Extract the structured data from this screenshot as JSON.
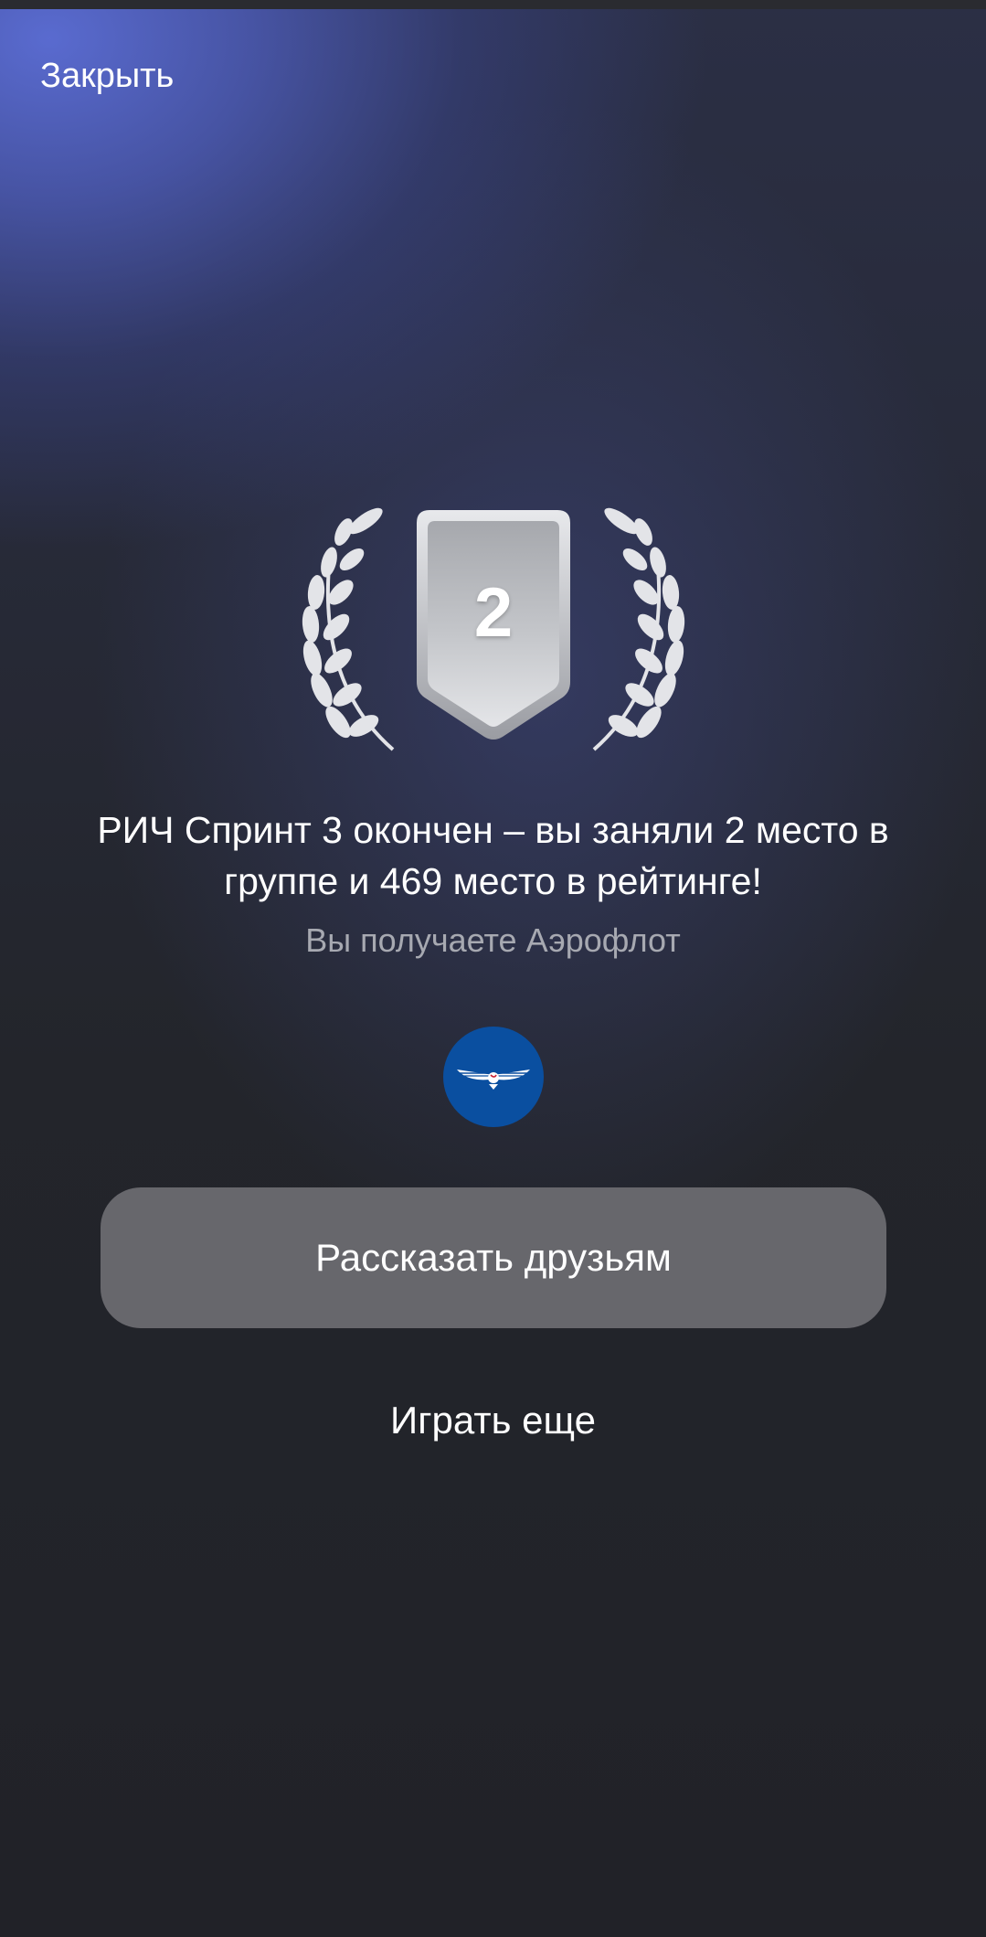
{
  "header": {
    "close_label": "Закрыть"
  },
  "award": {
    "place": "2",
    "medal_type": "silver"
  },
  "result": {
    "headline": "РИЧ Спринт 3 окончен – вы заняли 2 место в группе и 469 место в рейтинге!",
    "reward_text": "Вы получаете Аэрофлот"
  },
  "partner": {
    "icon": "aeroflot-logo-icon",
    "brand_color": "#0a4fa0"
  },
  "actions": {
    "share_label": "Рассказать друзьям",
    "play_again_label": "Играть еще"
  },
  "colors": {
    "accent_glow": "#5c6ed7",
    "background": "#23252b",
    "button_bg": "#67676c",
    "muted_text": "#a7a9b1"
  }
}
